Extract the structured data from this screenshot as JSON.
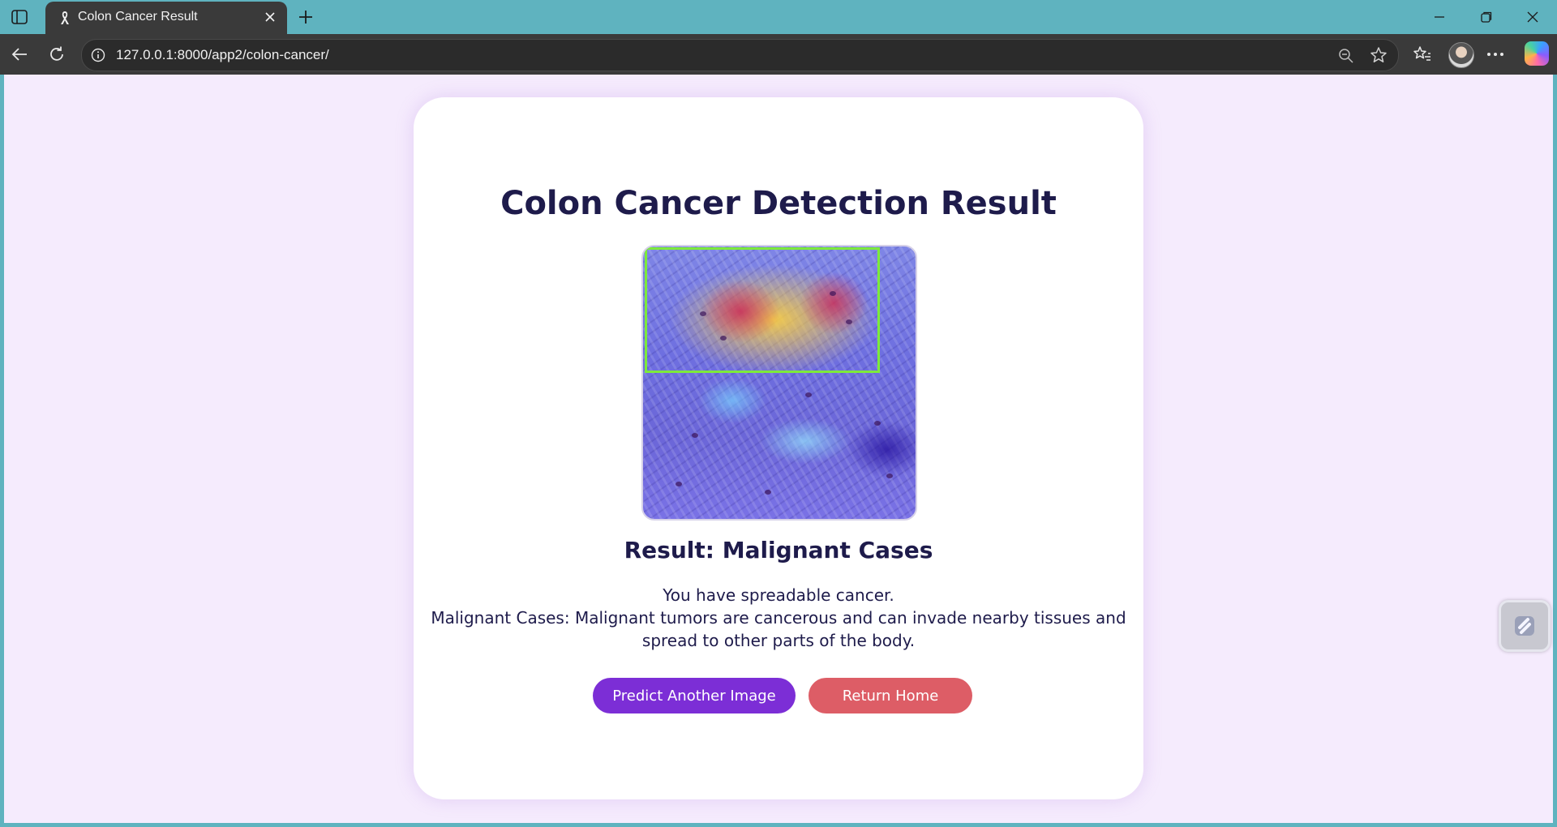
{
  "browser": {
    "tab_title": "Colon Cancer Result",
    "url": "127.0.0.1:8000/app2/colon-cancer/"
  },
  "page": {
    "title": "Colon Cancer Detection Result",
    "result_heading": "Result: Malignant Cases",
    "description_line1": "You have spreadable cancer.",
    "description_line2": "Malignant Cases: Malignant tumors are cancerous and can invade nearby tissues and spread to other parts of the body.",
    "predict_button": "Predict Another Image",
    "home_button": "Return Home"
  },
  "colors": {
    "page_background": "#f5ebfd",
    "title_text": "#1e1b4b",
    "predict_button": "#7c2ed6",
    "home_button": "#dd5d66",
    "detection_box": "#7dea3b"
  }
}
